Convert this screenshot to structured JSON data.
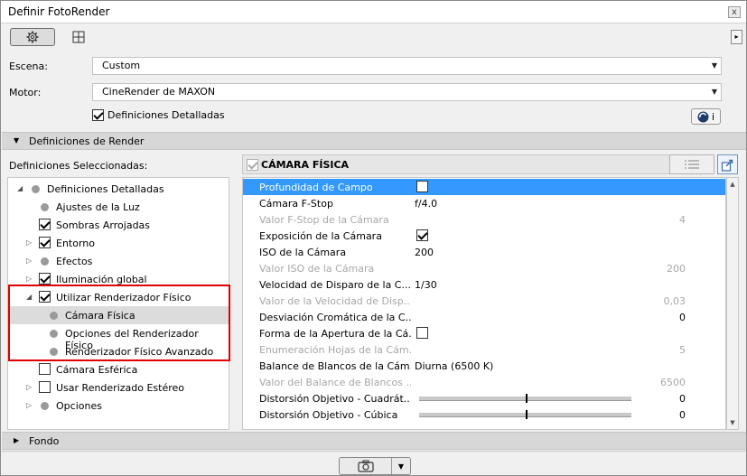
{
  "window": {
    "title": "Definir FotoRender",
    "close_label": "x"
  },
  "toolbar": {
    "more_label": "▸"
  },
  "scene": {
    "label": "Escena:",
    "value": "Custom"
  },
  "engine": {
    "label": "Motor:",
    "value": "CineRender de MAXON"
  },
  "detailed": {
    "label": "Definiciones Detalladas",
    "checked": true,
    "info_label": "i"
  },
  "sections": {
    "render": "Definiciones de Render",
    "background": "Fondo"
  },
  "selected_label": "Definiciones Seleccionadas:",
  "tree": [
    {
      "label": "Definiciones Detalladas",
      "indent": 0,
      "toggle": "open",
      "marker": "dot"
    },
    {
      "label": "Ajustes de la Luz",
      "indent": 1,
      "toggle": "none",
      "marker": "dot"
    },
    {
      "label": "Sombras Arrojadas",
      "indent": 1,
      "toggle": "none",
      "marker": "check-on"
    },
    {
      "label": "Entorno",
      "indent": 1,
      "toggle": "closed",
      "marker": "check-on"
    },
    {
      "label": "Efectos",
      "indent": 1,
      "toggle": "closed",
      "marker": "dot"
    },
    {
      "label": "Iluminación global",
      "indent": 1,
      "toggle": "closed",
      "marker": "check-on"
    },
    {
      "label": "Utilizar Renderizador Físico",
      "indent": 1,
      "toggle": "open",
      "marker": "check-on"
    },
    {
      "label": "Cámara Física",
      "indent": 2,
      "toggle": "none",
      "marker": "dot",
      "selected": true
    },
    {
      "label": "Opciones del Renderizador Físico",
      "indent": 2,
      "toggle": "none",
      "marker": "dot"
    },
    {
      "label": "Renderizador Físico Avanzado",
      "indent": 2,
      "toggle": "none",
      "marker": "dot"
    },
    {
      "label": "Cámara Esférica",
      "indent": 1,
      "toggle": "none",
      "marker": "check-off"
    },
    {
      "label": "Usar Renderizado Estéreo",
      "indent": 1,
      "toggle": "closed",
      "marker": "check-off"
    },
    {
      "label": "Opciones",
      "indent": 1,
      "toggle": "closed",
      "marker": "dot"
    }
  ],
  "panel": {
    "title": "CÁMARA FÍSICA"
  },
  "props": [
    {
      "label": "Profundidad de Campo",
      "kind": "check",
      "checked": false,
      "highlight": true
    },
    {
      "label": "Cámara F-Stop",
      "kind": "value",
      "value": "f/4.0"
    },
    {
      "label": "Valor F-Stop de la Cámara",
      "kind": "right",
      "value": "4",
      "disabled": true
    },
    {
      "label": "Exposición de la Cámara",
      "kind": "check",
      "checked": true
    },
    {
      "label": "ISO de la Cámara",
      "kind": "value",
      "value": "200"
    },
    {
      "label": "Valor ISO de la Cámara",
      "kind": "right",
      "value": "200",
      "disabled": true
    },
    {
      "label": "Velocidad de Disparo de la C...",
      "kind": "value",
      "value": "1/30"
    },
    {
      "label": "Valor de la Velocidad de Disp...",
      "kind": "right",
      "value": "0,03",
      "disabled": true
    },
    {
      "label": "Desviación Cromática de la C...",
      "kind": "right",
      "value": "0"
    },
    {
      "label": "Forma de la Apertura de la Cá...",
      "kind": "check",
      "checked": false
    },
    {
      "label": "Enumeración Hojas de la Cám...",
      "kind": "right",
      "value": "5",
      "disabled": true
    },
    {
      "label": "Balance de Blancos de la Cám...",
      "kind": "value",
      "value": "Diurna (6500 K)"
    },
    {
      "label": "Valor del Balance de Blancos ...",
      "kind": "right",
      "value": "6500",
      "disabled": true
    },
    {
      "label": "Distorsión Objetivo - Cuadrát...",
      "kind": "slider",
      "value": "0",
      "level": 0.5
    },
    {
      "label": "Distorsión Objetivo - Cúbica",
      "kind": "slider",
      "value": "0",
      "level": 0.5
    }
  ],
  "colors": {
    "highlight": "#3399ff",
    "annotation": "#e00000"
  },
  "icons": {
    "settings": "gear-icon",
    "layout": "grid-icon",
    "cinema": "cinema4d-icon",
    "list": "list-icon",
    "export": "export-icon",
    "camera": "camera-icon"
  }
}
